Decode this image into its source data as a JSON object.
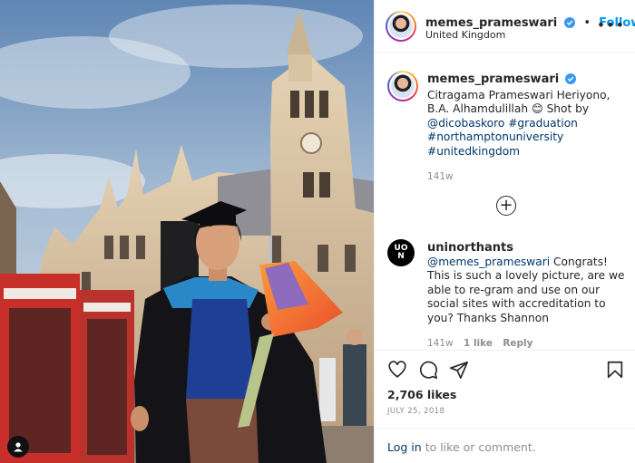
{
  "header": {
    "username": "memes_prameswari",
    "separator": "•",
    "follow_label": "Follow",
    "location": "United Kingdom",
    "more_label": "•••"
  },
  "caption": {
    "username": "memes_prameswari",
    "text_start": "Citragama Prameswari Heriyono, B.A. Alhamdulillah",
    "emoji": "😊",
    "shot_by": "Shot by",
    "mention": "@dicobaskoro",
    "hashtags": [
      "#graduation",
      "#northamptonuniversity",
      "#unitedkingdom"
    ],
    "age": "141w"
  },
  "load_more": {
    "symbol": "+"
  },
  "comment": {
    "logo_text": "UO\nN",
    "username": "uninorthants",
    "mention": "@memes_prameswari",
    "text": "Congrats! This is such a lovely picture, are we able to re-gram and use on our social sites with accreditation to you? Thanks Shannon",
    "age": "141w",
    "likes": "1 like",
    "reply_label": "Reply"
  },
  "post": {
    "likes": "2,706 likes",
    "date": "JULY 25, 2018"
  },
  "footer": {
    "login_label": "Log in",
    "rest": "to like or comment."
  },
  "colors": {
    "link_blue": "#00376b",
    "follow_blue": "#0095f6",
    "verified_blue": "#3897f0",
    "muted": "#8e8e8e"
  }
}
